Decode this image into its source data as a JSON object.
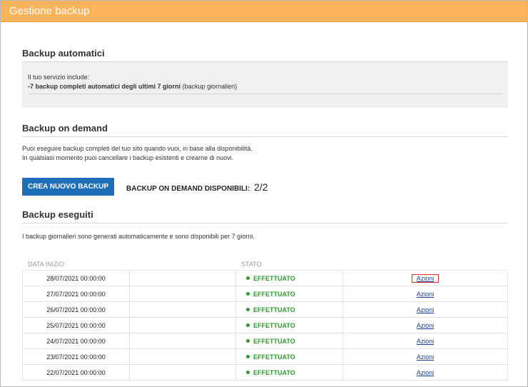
{
  "header": {
    "title": "Gestione backup"
  },
  "automatic": {
    "title": "Backup automatici",
    "intro": "Il tuo servizio include:",
    "bold": "-7 backup completi automatici degli ultimi 7 giorni",
    "note": "(backup giornalieri)"
  },
  "ondemand": {
    "title": "Backup on demand",
    "line1": "Puoi eseguire backup completi del tuo sito quando vuoi, in base alla disponibilità.",
    "line2": "In qualsiasi momento puoi cancellare i backup esistenti e crearne di nuovi.",
    "create_label": "CREA NUOVO BACKUP",
    "available_label": "BACKUP ON DEMAND DISPONIBILI:",
    "available_count": "2/2"
  },
  "done": {
    "title": "Backup eseguiti",
    "description": "I backup giornalieri sono generati automaticamente e sono disponibili per 7 giorni."
  },
  "table": {
    "col_date": "DATA INIZIO",
    "col_status": "STATO",
    "status_color": "#2e9a2e",
    "rows": [
      {
        "date": "28/07/2021 00:00:00",
        "status": "EFFETTUATO",
        "action": "Azioni"
      },
      {
        "date": "27/07/2021 00:00:00",
        "status": "EFFETTUATO",
        "action": "Azioni"
      },
      {
        "date": "26/07/2021 00:00:00",
        "status": "EFFETTUATO",
        "action": "Azioni"
      },
      {
        "date": "25/07/2021 00:00:00",
        "status": "EFFETTUATO",
        "action": "Azioni"
      },
      {
        "date": "24/07/2021 00:00:00",
        "status": "EFFETTUATO",
        "action": "Azioni"
      },
      {
        "date": "23/07/2021 00:00:00",
        "status": "EFFETTUATO",
        "action": "Azioni"
      },
      {
        "date": "22/07/2021 00:00:00",
        "status": "EFFETTUATO",
        "action": "Azioni"
      }
    ]
  }
}
